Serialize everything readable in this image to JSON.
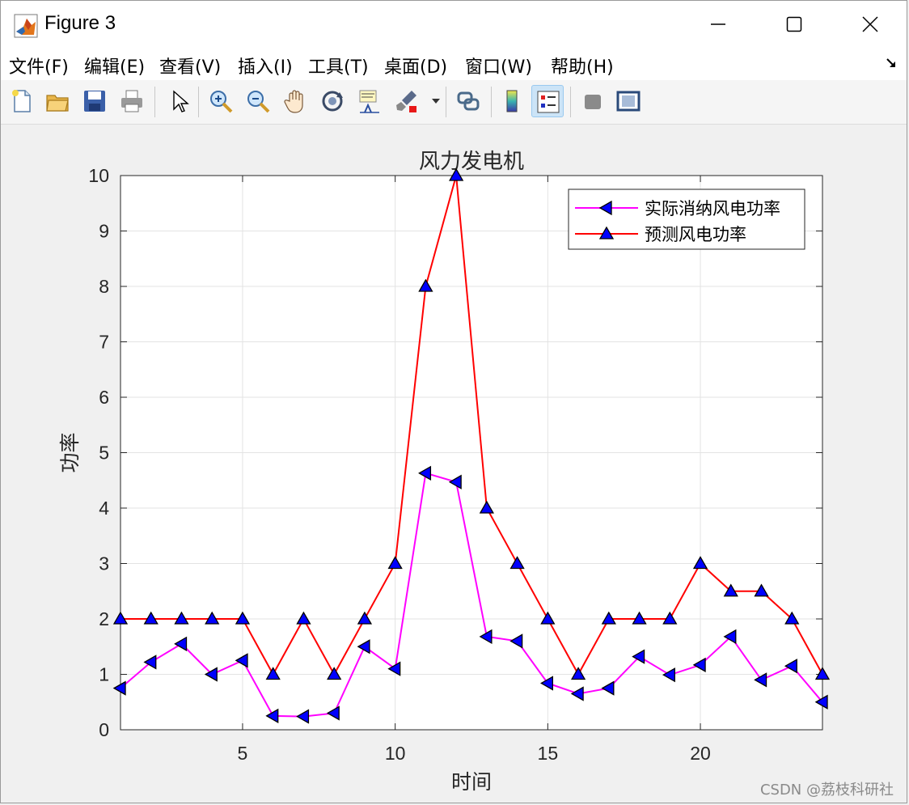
{
  "window": {
    "title": "Figure 3",
    "controls": [
      "minimize",
      "maximize",
      "close"
    ]
  },
  "menubar": {
    "items": [
      "文件(F)",
      "编辑(E)",
      "查看(V)",
      "插入(I)",
      "工具(T)",
      "桌面(D)",
      "窗口(W)",
      "帮助(H)"
    ]
  },
  "toolbar": {
    "buttons": [
      "new-figure-icon",
      "open-file-icon",
      "save-icon",
      "print-icon",
      "pointer-icon",
      "zoom-in-icon",
      "zoom-out-icon",
      "pan-icon",
      "rotate-3d-icon",
      "data-cursor-icon",
      "brush-icon",
      "link-plot-icon",
      "colorbar-icon",
      "legend-icon",
      "hide-plot-tools-icon",
      "show-plot-tools-icon"
    ],
    "active": "legend-icon"
  },
  "watermark": "CSDN @荔枝科研社",
  "chart_data": {
    "type": "line",
    "title": "风力发电机",
    "xlabel": "时间",
    "ylabel": "功率",
    "xlim": [
      1,
      24
    ],
    "ylim": [
      0,
      10
    ],
    "xticks": [
      5,
      10,
      15,
      20
    ],
    "yticks": [
      0,
      1,
      2,
      3,
      4,
      5,
      6,
      7,
      8,
      9,
      10
    ],
    "grid": true,
    "legend_position": "top-right",
    "x": [
      1,
      2,
      3,
      4,
      5,
      6,
      7,
      8,
      9,
      10,
      11,
      12,
      13,
      14,
      15,
      16,
      17,
      18,
      19,
      20,
      21,
      22,
      23,
      24
    ],
    "series": [
      {
        "name": "实际消纳风电功率",
        "color": "#ff00ff",
        "marker": "triangle-left",
        "values": [
          0.75,
          1.22,
          1.55,
          1.0,
          1.25,
          0.25,
          0.24,
          0.3,
          1.5,
          1.1,
          4.63,
          4.47,
          1.68,
          1.6,
          0.84,
          0.65,
          0.75,
          1.32,
          0.99,
          1.17,
          1.68,
          0.9,
          1.15,
          0.5
        ]
      },
      {
        "name": "预测风电功率",
        "color": "#ff0000",
        "marker": "triangle-up",
        "values": [
          2,
          2,
          2,
          2,
          2,
          1,
          2,
          1,
          2,
          3,
          8,
          10,
          4,
          3,
          2,
          1,
          2,
          2,
          2,
          3,
          2.5,
          2.5,
          2,
          1
        ]
      }
    ],
    "marker_fill": "#0000ff"
  }
}
